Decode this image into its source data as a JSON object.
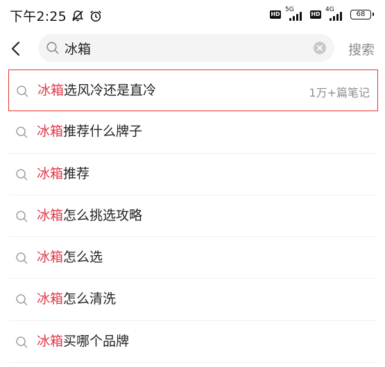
{
  "status_bar": {
    "time": "下午2:25",
    "network_1": "5G",
    "network_2": "4G",
    "battery": "68",
    "hd_label": "HD"
  },
  "search": {
    "query": "冰箱",
    "search_button": "搜索"
  },
  "suggestions": [
    {
      "keyword": "冰箱",
      "rest": "选风冷还是直冷",
      "count": "1万+篇笔记"
    },
    {
      "keyword": "冰箱",
      "rest": "推荐什么牌子"
    },
    {
      "keyword": "冰箱",
      "rest": "推荐"
    },
    {
      "keyword": "冰箱",
      "rest": "怎么挑选攻略"
    },
    {
      "keyword": "冰箱",
      "rest": "怎么选"
    },
    {
      "keyword": "冰箱",
      "rest": "怎么清洗"
    },
    {
      "keyword": "冰箱",
      "rest": "买哪个品牌"
    }
  ],
  "colors": {
    "keyword": "#e03a4a",
    "highlight_border": "#e5332a",
    "search_bg": "#f4f4f5"
  },
  "icons": [
    "mute-icon",
    "alarm-icon",
    "back-arrow-icon",
    "search-icon",
    "clear-icon"
  ]
}
